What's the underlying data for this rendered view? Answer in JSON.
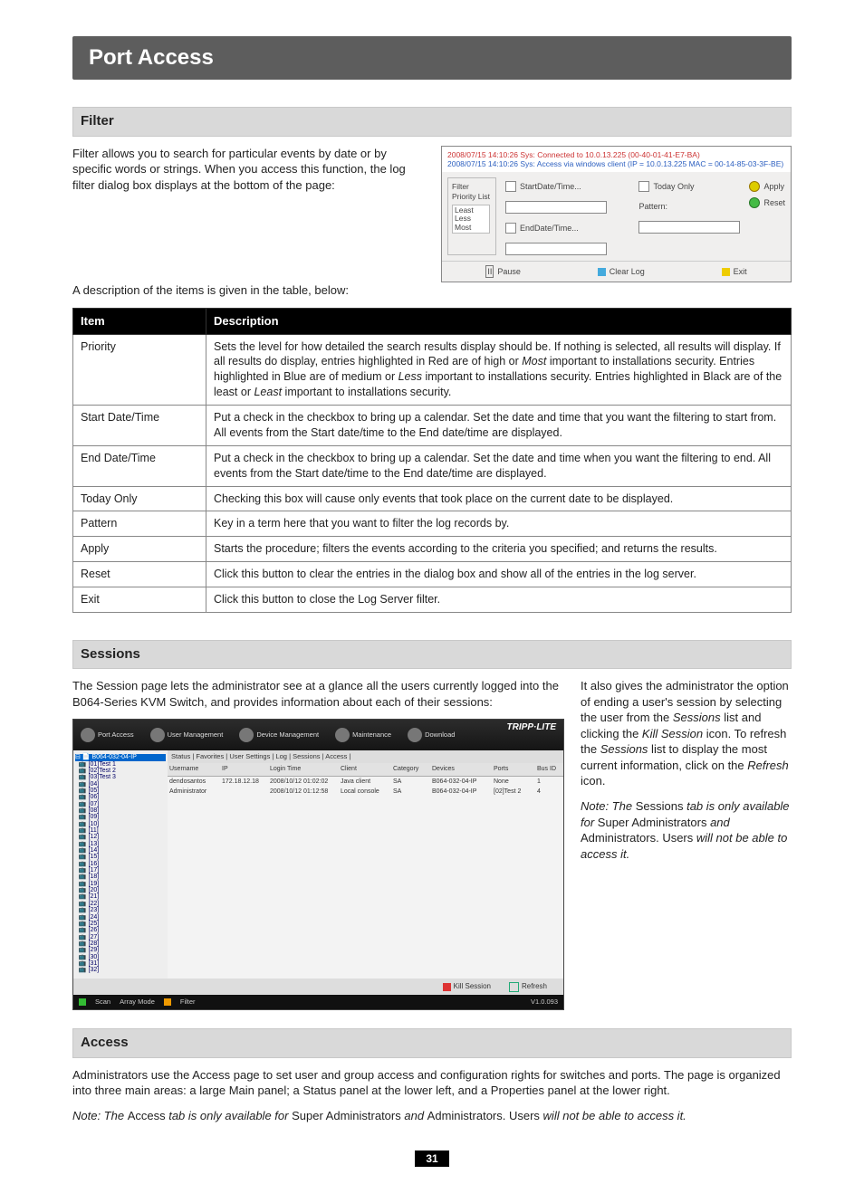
{
  "banner": "Port Access",
  "sections": {
    "filter": {
      "heading": "Filter",
      "intro": "Filter allows you to search for particular events by date or by specific words or strings. When you access this function, the log filter dialog box displays at the bottom of the page:",
      "table_intro": "A description of the items is given in the table, below:"
    },
    "sessions": {
      "heading": "Sessions",
      "left_para": "The Session page lets the administrator see at a glance all the users currently logged into the B064-Series KVM Switch, and provides information about each of their sessions:",
      "right_p1a": "It also gives the administrator the option of ending a user's session by selecting the user from the ",
      "right_p1b": "Sessions",
      "right_p1c": " list and clicking the ",
      "right_p1d": "Kill Session",
      "right_p1e": " icon. To refresh the ",
      "right_p1f": "Sessions",
      "right_p1g": " list to display the most current information, click on the ",
      "right_p1h": "Refresh",
      "right_p1i": " icon.",
      "note_a": "Note: The ",
      "note_b": "Sessions ",
      "note_c": "tab is only available for ",
      "note_d": "Super Administrators ",
      "note_e": "and ",
      "note_f": "Administrators. ",
      "note_g": "Users ",
      "note_h": "will not be able to access it."
    },
    "access": {
      "heading": "Access",
      "para": "Administrators use the Access page to set user and group access and configuration rights for switches and ports. The page is organized into three main areas: a large Main panel; a Status panel at the lower left, and a Properties panel at the lower right.",
      "note_a": "Note: The ",
      "note_b": "Access ",
      "note_c": "tab is only available for ",
      "note_d": "Super Administrators ",
      "note_e": "and ",
      "note_f": "Administrators. ",
      "note_g": "Users ",
      "note_h": "will not be able to access it."
    }
  },
  "filter_dialog": {
    "log1": "2008/07/15 14:10:26    Sys: Connected to 10.0.13.225 (00-40-01-41-E7-BA)",
    "log2": "2008/07/15 14:10:26    Sys: Access via windows client (IP = 10.0.13.225 MAC = 00-14-85-03-3F-BE)",
    "filter_label": "Filter",
    "priority_label": "Priority List",
    "priority_items": [
      "Least",
      "Less",
      "Most"
    ],
    "start": "StartDate/Time...",
    "end": "EndDate/Time...",
    "today": "Today Only",
    "pattern": "Pattern:",
    "apply": "Apply",
    "reset": "Reset",
    "pause": "Pause",
    "clearlog": "Clear Log",
    "exit": "Exit"
  },
  "table": {
    "head_item": "Item",
    "head_desc": "Description",
    "rows": [
      {
        "item": "Priority",
        "desc_a": "Sets the level for how detailed the search results display should be. If nothing is selected, all results will display. If all results do display, entries highlighted in Red are of high or ",
        "desc_b": "Most",
        "desc_c": " important to installations security. Entries highlighted in Blue are of medium or ",
        "desc_d": "Less",
        "desc_e": " important to installations security. Entries highlighted in Black are of the least or ",
        "desc_f": "Least",
        "desc_g": " important to installations security."
      },
      {
        "item": "Start Date/Time",
        "desc": "Put a check in the checkbox to bring up a calendar. Set the date and time that you want the filtering to start from. All events from the Start date/time to the End date/time are displayed."
      },
      {
        "item": "End Date/Time",
        "desc": "Put a check in the checkbox to bring up a calendar. Set the date and time when you want the filtering to end. All events from the Start date/time to the End date/time are displayed."
      },
      {
        "item": "Today Only",
        "desc": "Checking this box will cause only events that took place on the current date to be displayed."
      },
      {
        "item": "Pattern",
        "desc": "Key in a term here that you want to filter the log records by."
      },
      {
        "item": "Apply",
        "desc": "Starts the procedure; filters the events according to the criteria you specified; and returns the results."
      },
      {
        "item": "Reset",
        "desc": "Click this button to clear the entries in the dialog box and show all of the entries in the log server."
      },
      {
        "item": "Exit",
        "desc": "Click this button to close the Log Server filter."
      }
    ]
  },
  "sessions_mock": {
    "tabs": "Status | Favorites | User Settings | Log | Sessions | Access |",
    "logo": "TRIPP·LITE",
    "nav": [
      "Port Access",
      "User Management",
      "Device Management",
      "Maintenance",
      "Download"
    ],
    "tree_root": "B064-032-04-IP",
    "tree_named": [
      "[01]Test 1",
      "[02]Test 2",
      "[03]Test 3"
    ],
    "tree_generic": [
      "[04]",
      "[05]",
      "[06]",
      "[07]",
      "[08]",
      "[09]",
      "[10]",
      "[11]",
      "[12]",
      "[13]",
      "[14]",
      "[15]",
      "[16]",
      "[17]",
      "[18]",
      "[19]",
      "[20]",
      "[21]",
      "[22]",
      "[23]",
      "[24]",
      "[25]",
      "[26]",
      "[27]",
      "[28]",
      "[29]",
      "[30]",
      "[31]",
      "[32]"
    ],
    "headers": [
      "Username",
      "IP",
      "Login Time",
      "Client",
      "Category",
      "Devices",
      "Ports",
      "Bus ID"
    ],
    "row1": [
      "dendosantos",
      "172.18.12.18",
      "2008/10/12 01:02:02",
      "Java client",
      "SA",
      "B064-032-04-IP",
      "None",
      "1"
    ],
    "row2": [
      "Administrator",
      "",
      "2008/10/12 01:12:58",
      "Local console",
      "SA",
      "B064-032-04-IP",
      "[02]Test 2",
      "4"
    ],
    "kill": "Kill Session",
    "refresh": "Refresh",
    "scan": "Scan",
    "array": "Array Mode",
    "filter": "Filter",
    "version": "V1.0.093"
  },
  "page_number": "31"
}
